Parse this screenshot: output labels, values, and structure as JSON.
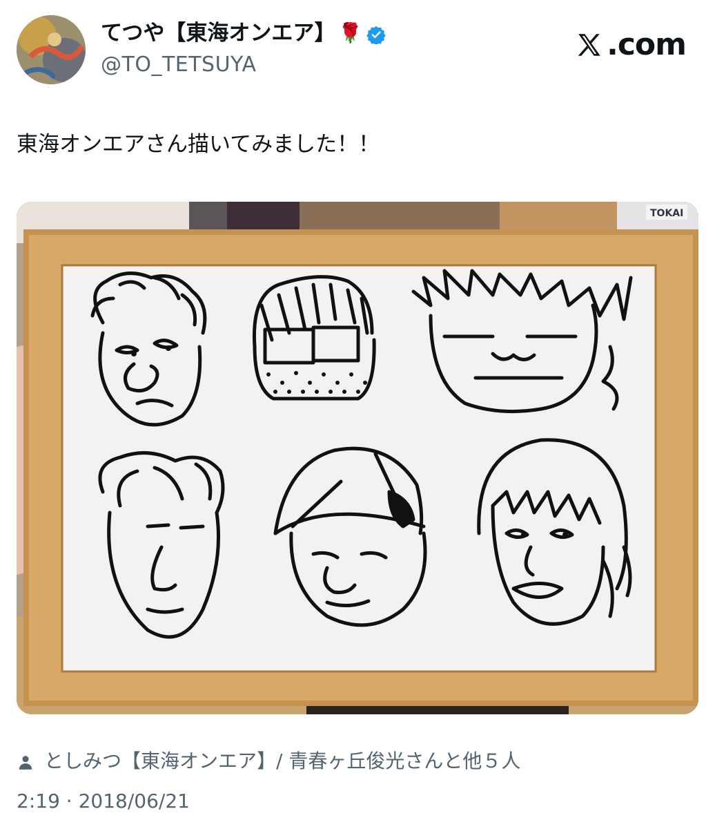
{
  "author": {
    "display_name": "てつや【東海オンエア】",
    "emoji": "🌹",
    "verified": true,
    "handle": "@TO_TETSUYA"
  },
  "brand": {
    "text": ".com",
    "logo_icon": "x-logo-icon"
  },
  "tweet": {
    "text": "東海オンエアさん描いてみました！！"
  },
  "tagged": {
    "icon": "person-icon",
    "text": "としみつ【東海オンエア】/ 青春ヶ丘俊光さんと他５人"
  },
  "meta": {
    "time": "2:19",
    "separator": " · ",
    "date": "2018/06/21"
  },
  "media": {
    "background_sign": "TOKAI"
  },
  "colors": {
    "verified_blue": "#1d9bf0",
    "secondary_text": "#536471",
    "primary_text": "#0f1419"
  }
}
